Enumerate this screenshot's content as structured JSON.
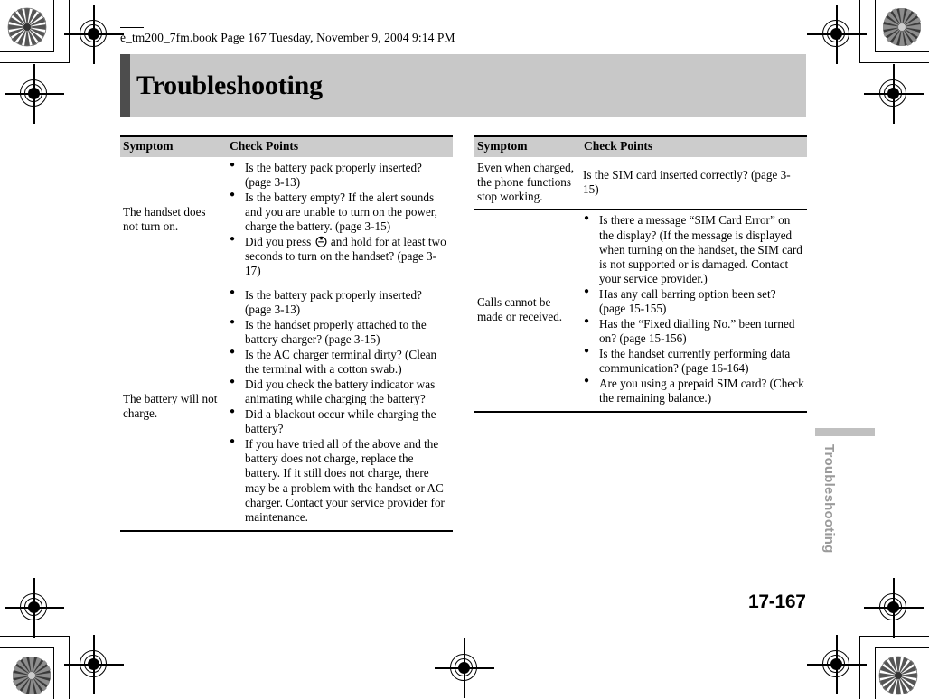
{
  "header": {
    "filestamp": "e_tm200_7fm.book  Page 167  Tuesday, November 9, 2004  9:14 PM"
  },
  "banner": {
    "title": "Troubleshooting",
    "bar_color": "#4d4d4d",
    "background_color": "#c8c8c8"
  },
  "tables": {
    "left": {
      "columns": [
        "Symptom",
        "Check Points"
      ],
      "rows": [
        {
          "symptom": "The handset does not turn on.",
          "points": [
            "Is the battery pack properly inserted? (page 3-13)",
            "Is the battery empty? If the alert sounds and you are unable to turn on the power, charge the battery. (page 3-15)",
            "Did you press ⓘ and hold for at least two seconds to turn on the handset? (page 3-17)"
          ],
          "points_parts": [
            [
              "Is the battery pack properly inserted? (page 3-13)"
            ],
            [
              "Is the battery empty? If the alert sounds and you are unable to turn on the power, charge the battery. (page 3-15)"
            ],
            [
              "Did you press ",
              "power-key-icon",
              " and hold for at least two seconds to turn on the handset? (page 3-17)"
            ]
          ]
        },
        {
          "symptom": "The battery will not charge.",
          "points": [
            "Is the battery pack properly inserted? (page 3-13)",
            "Is the handset properly attached to the battery charger? (page 3-15)",
            "Is the AC charger terminal dirty? (Clean the terminal with a cotton swab.)",
            "Did you check the battery indicator was animating while charging the battery?",
            "Did a blackout occur while charging the battery?",
            "If you have tried all of the above and the battery does not charge, replace the battery. If it still does not charge, there may be a problem with the handset or AC charger. Contact your service provider for maintenance."
          ]
        }
      ]
    },
    "right": {
      "columns": [
        "Symptom",
        "Check Points"
      ],
      "rows": [
        {
          "symptom": "Even when charged, the phone functions stop working.",
          "plain_text": "Is the SIM card inserted correctly? (page 3-15)",
          "points": []
        },
        {
          "symptom": "Calls cannot be made or received.",
          "points": [
            "Is there a message “SIM Card Error” on the display? (If the message is displayed when turning on the handset, the SIM card is not supported or is damaged. Contact your service provider.)",
            "Has any call barring option been set? (page 15-155)",
            "Has the “Fixed dialling No.” been turned on? (page 15-156)",
            "Is the handset currently performing data communication? (page 16-164)",
            "Are you using a prepaid SIM card? (Check the remaining balance.)"
          ]
        }
      ]
    }
  },
  "side_tab": {
    "label": "Troubleshooting",
    "color": "#9a9a9a"
  },
  "folio": {
    "page_number": "17-167"
  }
}
